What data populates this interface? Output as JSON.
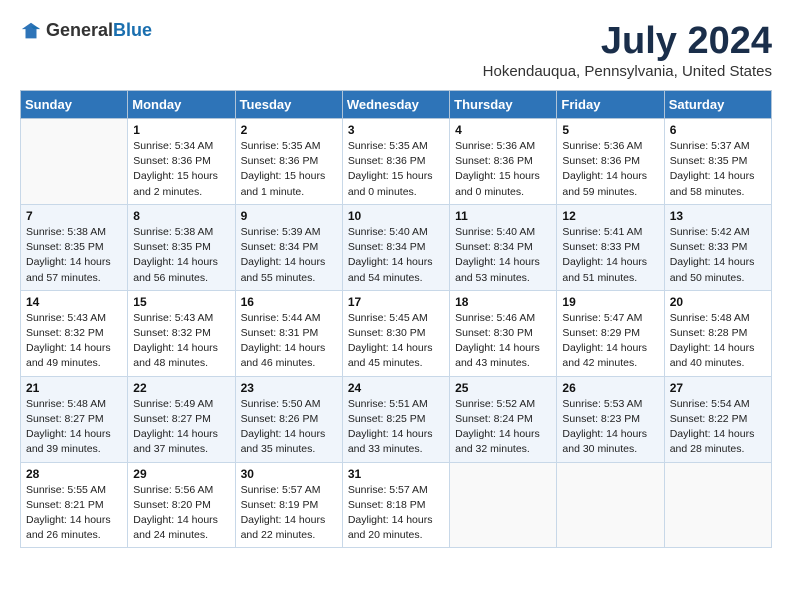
{
  "header": {
    "logo_general": "General",
    "logo_blue": "Blue",
    "title": "July 2024",
    "subtitle": "Hokendauqua, Pennsylvania, United States"
  },
  "days_of_week": [
    "Sunday",
    "Monday",
    "Tuesday",
    "Wednesday",
    "Thursday",
    "Friday",
    "Saturday"
  ],
  "weeks": [
    [
      {
        "day": "",
        "info": ""
      },
      {
        "day": "1",
        "info": "Sunrise: 5:34 AM\nSunset: 8:36 PM\nDaylight: 15 hours\nand 2 minutes."
      },
      {
        "day": "2",
        "info": "Sunrise: 5:35 AM\nSunset: 8:36 PM\nDaylight: 15 hours\nand 1 minute."
      },
      {
        "day": "3",
        "info": "Sunrise: 5:35 AM\nSunset: 8:36 PM\nDaylight: 15 hours\nand 0 minutes."
      },
      {
        "day": "4",
        "info": "Sunrise: 5:36 AM\nSunset: 8:36 PM\nDaylight: 15 hours\nand 0 minutes."
      },
      {
        "day": "5",
        "info": "Sunrise: 5:36 AM\nSunset: 8:36 PM\nDaylight: 14 hours\nand 59 minutes."
      },
      {
        "day": "6",
        "info": "Sunrise: 5:37 AM\nSunset: 8:35 PM\nDaylight: 14 hours\nand 58 minutes."
      }
    ],
    [
      {
        "day": "7",
        "info": "Sunrise: 5:38 AM\nSunset: 8:35 PM\nDaylight: 14 hours\nand 57 minutes."
      },
      {
        "day": "8",
        "info": "Sunrise: 5:38 AM\nSunset: 8:35 PM\nDaylight: 14 hours\nand 56 minutes."
      },
      {
        "day": "9",
        "info": "Sunrise: 5:39 AM\nSunset: 8:34 PM\nDaylight: 14 hours\nand 55 minutes."
      },
      {
        "day": "10",
        "info": "Sunrise: 5:40 AM\nSunset: 8:34 PM\nDaylight: 14 hours\nand 54 minutes."
      },
      {
        "day": "11",
        "info": "Sunrise: 5:40 AM\nSunset: 8:34 PM\nDaylight: 14 hours\nand 53 minutes."
      },
      {
        "day": "12",
        "info": "Sunrise: 5:41 AM\nSunset: 8:33 PM\nDaylight: 14 hours\nand 51 minutes."
      },
      {
        "day": "13",
        "info": "Sunrise: 5:42 AM\nSunset: 8:33 PM\nDaylight: 14 hours\nand 50 minutes."
      }
    ],
    [
      {
        "day": "14",
        "info": "Sunrise: 5:43 AM\nSunset: 8:32 PM\nDaylight: 14 hours\nand 49 minutes."
      },
      {
        "day": "15",
        "info": "Sunrise: 5:43 AM\nSunset: 8:32 PM\nDaylight: 14 hours\nand 48 minutes."
      },
      {
        "day": "16",
        "info": "Sunrise: 5:44 AM\nSunset: 8:31 PM\nDaylight: 14 hours\nand 46 minutes."
      },
      {
        "day": "17",
        "info": "Sunrise: 5:45 AM\nSunset: 8:30 PM\nDaylight: 14 hours\nand 45 minutes."
      },
      {
        "day": "18",
        "info": "Sunrise: 5:46 AM\nSunset: 8:30 PM\nDaylight: 14 hours\nand 43 minutes."
      },
      {
        "day": "19",
        "info": "Sunrise: 5:47 AM\nSunset: 8:29 PM\nDaylight: 14 hours\nand 42 minutes."
      },
      {
        "day": "20",
        "info": "Sunrise: 5:48 AM\nSunset: 8:28 PM\nDaylight: 14 hours\nand 40 minutes."
      }
    ],
    [
      {
        "day": "21",
        "info": "Sunrise: 5:48 AM\nSunset: 8:27 PM\nDaylight: 14 hours\nand 39 minutes."
      },
      {
        "day": "22",
        "info": "Sunrise: 5:49 AM\nSunset: 8:27 PM\nDaylight: 14 hours\nand 37 minutes."
      },
      {
        "day": "23",
        "info": "Sunrise: 5:50 AM\nSunset: 8:26 PM\nDaylight: 14 hours\nand 35 minutes."
      },
      {
        "day": "24",
        "info": "Sunrise: 5:51 AM\nSunset: 8:25 PM\nDaylight: 14 hours\nand 33 minutes."
      },
      {
        "day": "25",
        "info": "Sunrise: 5:52 AM\nSunset: 8:24 PM\nDaylight: 14 hours\nand 32 minutes."
      },
      {
        "day": "26",
        "info": "Sunrise: 5:53 AM\nSunset: 8:23 PM\nDaylight: 14 hours\nand 30 minutes."
      },
      {
        "day": "27",
        "info": "Sunrise: 5:54 AM\nSunset: 8:22 PM\nDaylight: 14 hours\nand 28 minutes."
      }
    ],
    [
      {
        "day": "28",
        "info": "Sunrise: 5:55 AM\nSunset: 8:21 PM\nDaylight: 14 hours\nand 26 minutes."
      },
      {
        "day": "29",
        "info": "Sunrise: 5:56 AM\nSunset: 8:20 PM\nDaylight: 14 hours\nand 24 minutes."
      },
      {
        "day": "30",
        "info": "Sunrise: 5:57 AM\nSunset: 8:19 PM\nDaylight: 14 hours\nand 22 minutes."
      },
      {
        "day": "31",
        "info": "Sunrise: 5:57 AM\nSunset: 8:18 PM\nDaylight: 14 hours\nand 20 minutes."
      },
      {
        "day": "",
        "info": ""
      },
      {
        "day": "",
        "info": ""
      },
      {
        "day": "",
        "info": ""
      }
    ]
  ]
}
